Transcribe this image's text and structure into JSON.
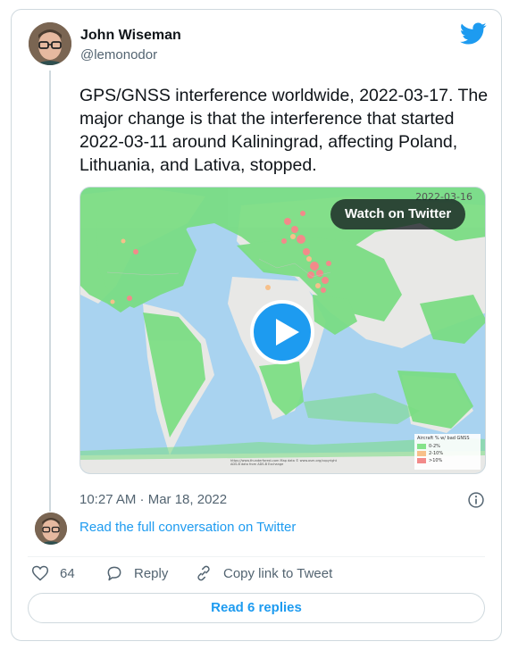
{
  "author": {
    "name": "John Wiseman",
    "handle": "@lemonodor"
  },
  "tweet": {
    "text": "GPS/GNSS interference worldwide, 2022-03-17. The major change is that the interference that started 2022-03-11 around Kaliningrad, affecting Poland, Lithuania, and Lativa, stopped.",
    "timestamp": "10:27 AM · Mar 18, 2022"
  },
  "media": {
    "map_date": "2022-03-16",
    "watch_label": "Watch on Twitter",
    "legend_title": "Aircraft % w/ bad GNSS",
    "legend": [
      {
        "label": "0-2%",
        "color": "#86e38b"
      },
      {
        "label": "2-10%",
        "color": "#f7c08a"
      },
      {
        "label": ">10%",
        "color": "#f28a8a"
      }
    ],
    "credit": "https://www.thunderforest.com Map data © www.osm.org/copyright ADS-B data from ADS-B Exchange"
  },
  "conversation_link": "Read the full conversation on Twitter",
  "actions": {
    "like_count": "64",
    "reply_label": "Reply",
    "copy_label": "Copy link to Tweet"
  },
  "replies_button": "Read 6 replies",
  "colors": {
    "accent": "#1d9bf0",
    "text": "#0f1419",
    "muted": "#536471",
    "border": "#cfd9de",
    "interference_ok": "#86e38b",
    "interference_bad": "#f28a8a"
  }
}
